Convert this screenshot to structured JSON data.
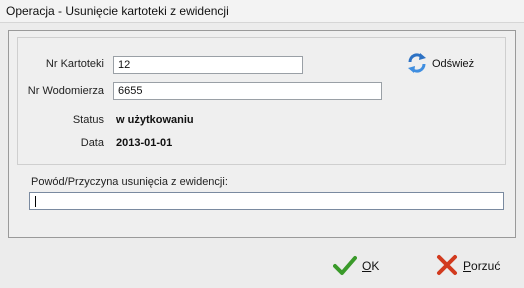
{
  "window": {
    "title": "Operacja - Usunięcie kartoteki z ewidencji"
  },
  "form": {
    "nr_kartoteki_label": "Nr Kartoteki",
    "nr_kartoteki_value": "12",
    "nr_wodomierza_label": "Nr Wodomierza",
    "nr_wodomierza_value": "6655",
    "status_label": "Status",
    "status_value": "w użytkowaniu",
    "data_label": "Data",
    "data_value": "2013-01-01"
  },
  "refresh": {
    "label": "Odśwież",
    "icon": "refresh-icon"
  },
  "reason": {
    "label": "Powód/Przyczyna usunięcia z ewidencji:",
    "value": ""
  },
  "buttons": {
    "ok": {
      "mnemonic": "O",
      "rest": "K",
      "icon": "check-icon",
      "color": "#3a9a2a"
    },
    "cancel": {
      "mnemonic": "P",
      "rest": "orzuć",
      "icon": "cross-icon",
      "color": "#d23a1e"
    }
  }
}
